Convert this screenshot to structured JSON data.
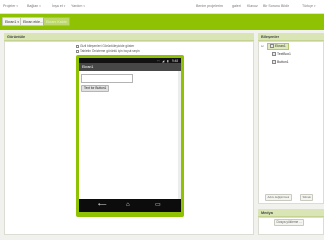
{
  "menu": {
    "projects": "Projeler",
    "connect": "Bağlan",
    "build": "İnşa et",
    "help": "Yardım",
    "my_projects": "Benim projelerim",
    "gallery": "galeri",
    "guide": "Klavuz",
    "report_issue": "Bir Sorunu Bildir",
    "language": "Türkçe"
  },
  "toolbar": {
    "screen_select": "Ekran1",
    "add_screen": "Ekran ekle...",
    "remove_screen": "Ekranı Kaldır"
  },
  "viewer": {
    "title": "Görüntüle",
    "hidden_components_label": "Gizli bileşenleri Görüntüleyicide göster",
    "tablet_preview_label": "Tabletin Önizleme görüntü için boyut seçin",
    "screen_title": "Ekran1",
    "button_text": "Text for Button1",
    "status_icons": [
      "wifi-icon",
      "signal-icon",
      "battery-icon"
    ],
    "time": "9:48"
  },
  "components": {
    "title": "Bileşenler",
    "tree": [
      {
        "label": "Ekran1",
        "selected": true
      },
      {
        "label": "TextBox1",
        "selected": false
      },
      {
        "label": "Button1",
        "selected": false
      }
    ],
    "rename_button": "Adını değiştirmek",
    "delete_button": "Silmek"
  },
  "media": {
    "title": "Medya",
    "upload_button": "Dosya yükleme ..."
  },
  "colors": {
    "accent": "#8fc202",
    "panel_header": "#d9e5b5",
    "background": "#f1f1ed"
  }
}
